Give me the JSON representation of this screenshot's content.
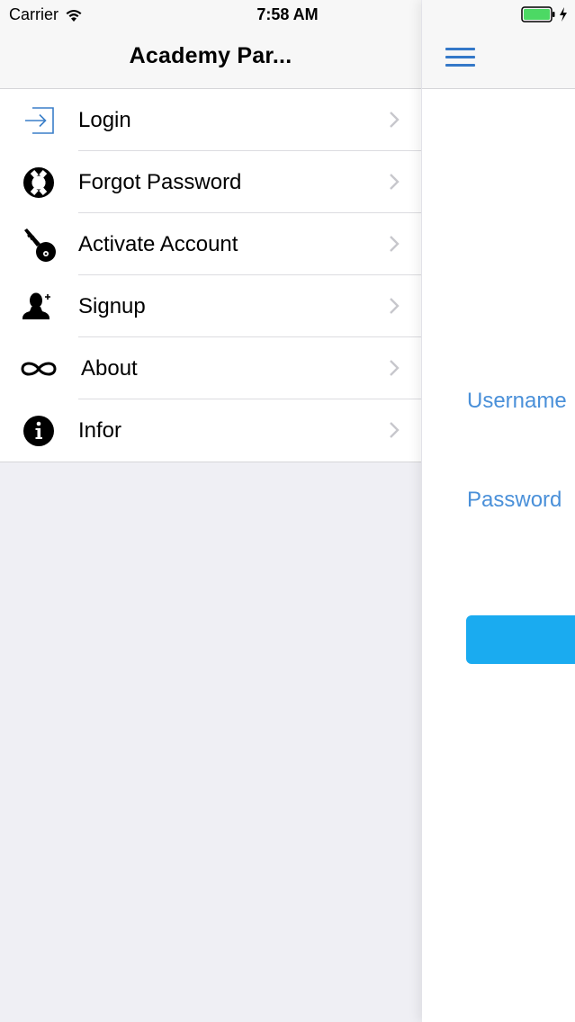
{
  "status_bar": {
    "carrier": "Carrier",
    "time": "7:58 AM",
    "battery_color": "#4cd964"
  },
  "menu": {
    "title": "Academy Par...",
    "items": [
      {
        "label": "Login",
        "icon": "login-icon"
      },
      {
        "label": "Forgot Password",
        "icon": "lifebuoy-icon"
      },
      {
        "label": "Activate Account",
        "icon": "key-icon"
      },
      {
        "label": "Signup",
        "icon": "add-user-icon"
      },
      {
        "label": "About",
        "icon": "infinity-icon"
      },
      {
        "label": "Infor",
        "icon": "info-icon"
      }
    ]
  },
  "content": {
    "username_label": "Username",
    "password_label": "Password",
    "accent_color": "#4a90d9",
    "button_color": "#1aabf0"
  }
}
